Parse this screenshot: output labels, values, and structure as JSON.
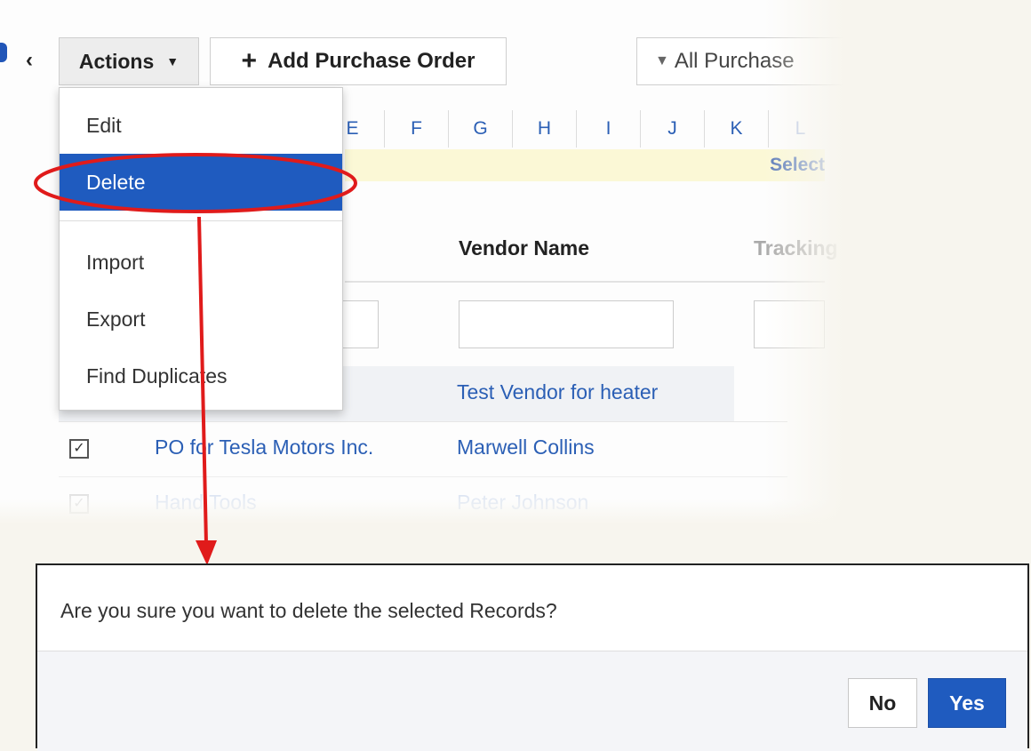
{
  "toolbar": {
    "collapse_glyph": "‹",
    "actions_label": "Actions",
    "caret_glyph": "▼",
    "add_po_plus": "+",
    "add_po_label": "Add Purchase Order",
    "filter_funnel": "▼",
    "filter_label": "All Purchase"
  },
  "alphabet": [
    "E",
    "F",
    "G",
    "H",
    "I",
    "J",
    "K",
    "L"
  ],
  "notice_text": "Select",
  "table": {
    "headers": {
      "vendor": "Vendor Name",
      "tracking": "Tracking"
    },
    "rows": [
      {
        "checked": false,
        "subject": "",
        "vendor": "Test Vendor for heater"
      },
      {
        "checked": true,
        "subject": "PO for Tesla Motors Inc.",
        "vendor": "Marwell Collins"
      },
      {
        "checked": true,
        "subject": "Hand Tools",
        "vendor": "Peter Johnson"
      }
    ],
    "check_glyph": "✓"
  },
  "actions_menu": {
    "items": [
      {
        "label": "Edit"
      },
      {
        "label": "Delete",
        "active": true
      },
      {
        "label": "Import"
      },
      {
        "label": "Export"
      },
      {
        "label": "Find Duplicates"
      }
    ]
  },
  "annotation_color": "#e01b1b",
  "accent_color": "#1f5bbf",
  "dialog": {
    "message": "Are you sure you want to delete the selected Records?",
    "no_label": "No",
    "yes_label": "Yes"
  }
}
